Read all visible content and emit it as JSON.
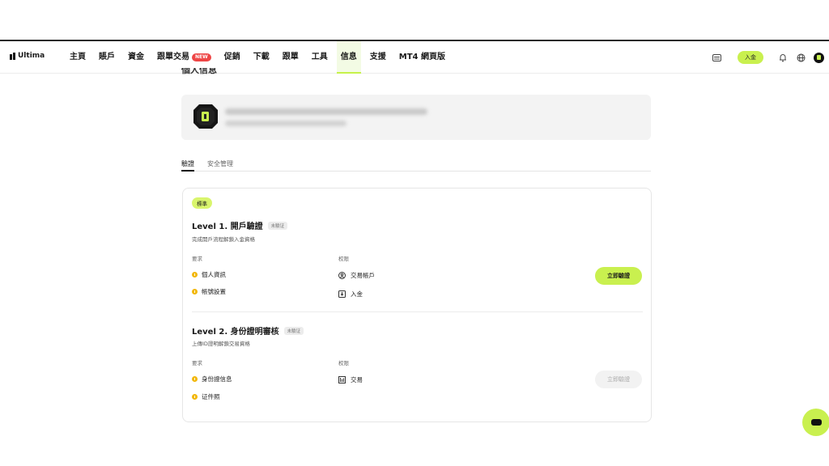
{
  "brand": {
    "name": "Ultima"
  },
  "nav": {
    "items": [
      {
        "label": "主頁",
        "active": false
      },
      {
        "label": "賬戶",
        "active": false
      },
      {
        "label": "資金",
        "active": false
      },
      {
        "label": "跟單交易",
        "active": false,
        "badge": "NEW"
      },
      {
        "label": "促銷",
        "active": false
      },
      {
        "label": "下載",
        "active": false
      },
      {
        "label": "跟單",
        "active": false
      },
      {
        "label": "工具",
        "active": false
      },
      {
        "label": "信息",
        "active": true
      },
      {
        "label": "支援",
        "active": false
      },
      {
        "label": "MT4 網頁版",
        "active": false
      }
    ],
    "deposit_label": "入金"
  },
  "page": {
    "heading": "個人信息"
  },
  "tabs": [
    {
      "label": "驗證",
      "active": true
    },
    {
      "label": "安全管理",
      "active": false
    }
  ],
  "verification": {
    "tag": "標準",
    "levels": [
      {
        "title": "Level 1. 開戶驗證",
        "status": "未驗证",
        "description": "完成開戶流程解鎖入金資格",
        "requirements_label": "要求",
        "permissions_label": "权限",
        "requirements": [
          "個人資訊",
          "帳號設置"
        ],
        "permissions": [
          {
            "label": "交易帳戶",
            "icon": "user-circle-icon"
          },
          {
            "label": "入金",
            "icon": "deposit-box-icon"
          }
        ],
        "button_label": "立即驗證",
        "button_enabled": true
      },
      {
        "title": "Level 2. 身份證明審核",
        "status": "未驗证",
        "description": "上傳ID證明解鎖交易資格",
        "requirements_label": "要求",
        "permissions_label": "权限",
        "requirements": [
          "身份證信息",
          "证件照"
        ],
        "permissions": [
          {
            "label": "交易",
            "icon": "chart-icon"
          }
        ],
        "button_label": "立即驗證",
        "button_enabled": false
      }
    ]
  },
  "colors": {
    "accent": "#c9f04f",
    "badge": "#ee4646",
    "warning": "#f2b705"
  }
}
